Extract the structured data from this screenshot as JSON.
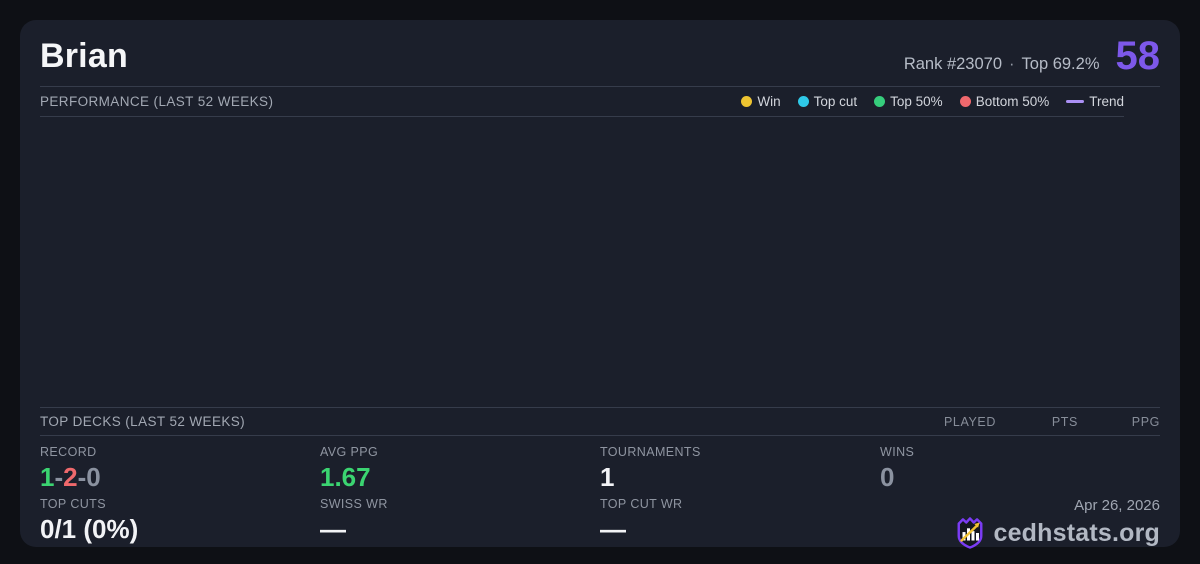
{
  "colors": {
    "accent_purple": "#7d58ea",
    "green": "#3bd471",
    "red": "#ef696c",
    "muted": "#8b92a0",
    "white": "#f2f3f6",
    "win_dot": "#eec431",
    "top_cut_dot": "#2fc9e8",
    "top50_dot": "#36cd7c",
    "bottom50_dot": "#ef686d",
    "trend_line": "#ab90f5"
  },
  "header": {
    "title": "Brian",
    "rank": "Rank #23070",
    "dot_separator": "·",
    "top_percent": "Top 69.2%",
    "score": "58"
  },
  "performance": {
    "title": "PERFORMANCE (LAST 52 WEEKS)",
    "chart_empty": true,
    "legend": [
      {
        "label": "Win",
        "color": "#eec431",
        "swatch": "dot"
      },
      {
        "label": "Top cut",
        "color": "#2fc9e8",
        "swatch": "dot"
      },
      {
        "label": "Top 50%",
        "color": "#36cd7c",
        "swatch": "dot"
      },
      {
        "label": "Bottom 50%",
        "color": "#ef686d",
        "swatch": "dot"
      },
      {
        "label": "Trend",
        "color": "#ab90f5",
        "swatch": "line"
      }
    ]
  },
  "top_decks": {
    "title": "TOP DECKS (LAST 52 WEEKS)",
    "columns": [
      "PLAYED",
      "PTS",
      "PPG"
    ],
    "rows": []
  },
  "stats": {
    "record": {
      "label": "RECORD",
      "win": "1",
      "sep": "-",
      "loss": "2",
      "draw": "0"
    },
    "avg_ppg": {
      "label": "AVG PPG",
      "value": "1.67"
    },
    "tournaments": {
      "label": "TOURNAMENTS",
      "value": "1"
    },
    "wins": {
      "label": "WINS",
      "value": "0"
    },
    "top_cuts": {
      "label": "TOP CUTS",
      "value": "0/1 (0%)"
    },
    "swiss_wr": {
      "label": "SWISS WR",
      "value": "—"
    },
    "top_cut_wr": {
      "label": "TOP CUT WR",
      "value": "—"
    }
  },
  "footer": {
    "date": "Apr 26, 2026",
    "site": "cedhstats.org",
    "logo": "cedhstats-shield-logo"
  }
}
